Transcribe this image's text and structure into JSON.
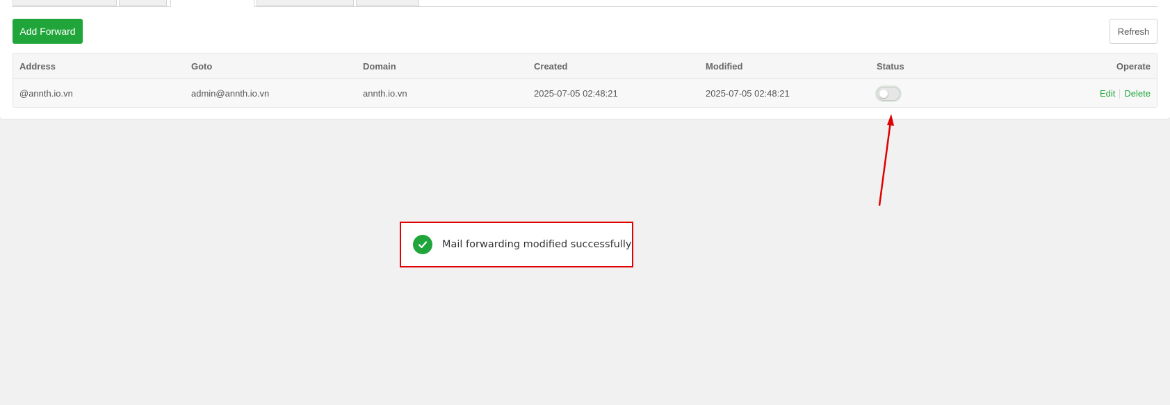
{
  "toolbar": {
    "add_label": "Add Forward",
    "refresh_label": "Refresh"
  },
  "table": {
    "columns": [
      "Address",
      "Goto",
      "Domain",
      "Created",
      "Modified",
      "Status",
      "Operate"
    ],
    "rows": [
      {
        "address": "@annth.io.vn",
        "goto": "admin@annth.io.vn",
        "domain": "annth.io.vn",
        "created": "2025-07-05 02:48:21",
        "modified": "2025-07-05 02:48:21",
        "status_enabled": false,
        "edit_label": "Edit",
        "delete_label": "Delete"
      }
    ]
  },
  "toast": {
    "message": "Mail forwarding modified successfully",
    "icon": "check-circle-icon"
  },
  "colors": {
    "accent": "#20a53a",
    "annotation": "#e00000",
    "background": "#f1f1f1"
  }
}
